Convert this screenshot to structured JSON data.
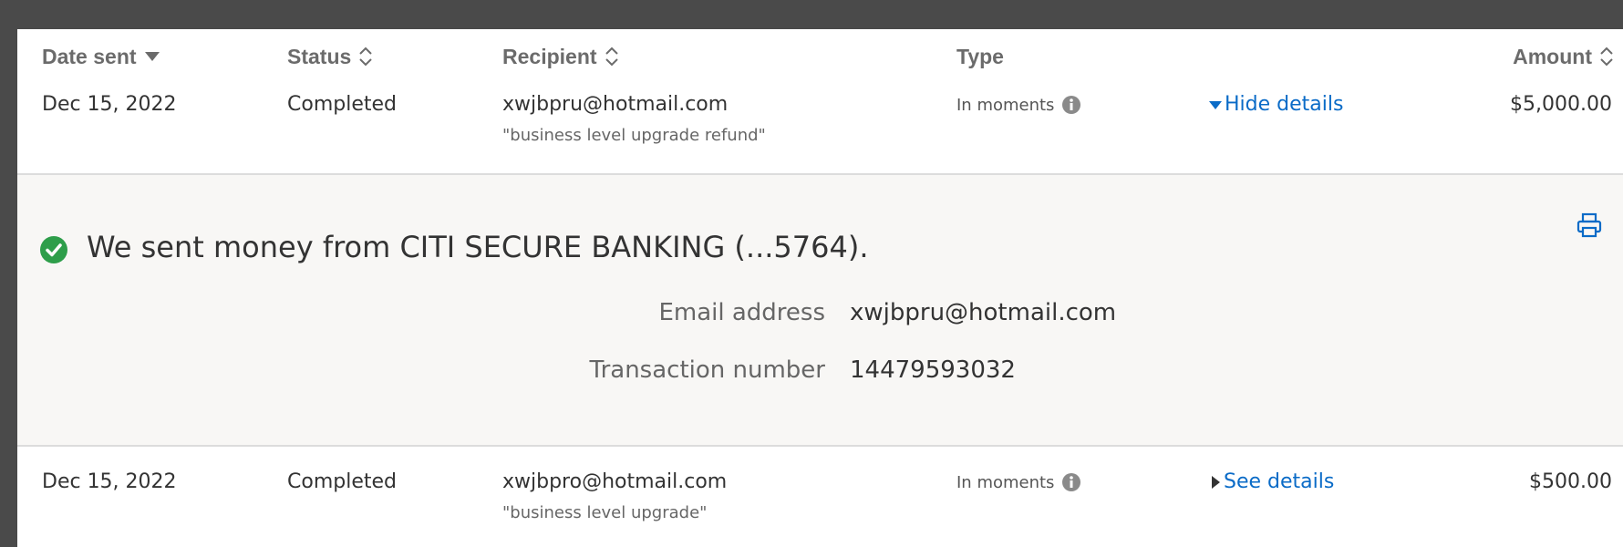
{
  "columns": {
    "date_sent": "Date sent",
    "status": "Status",
    "recipient": "Recipient",
    "type": "Type",
    "amount": "Amount"
  },
  "rows": [
    {
      "date": "Dec 15, 2022",
      "status": "Completed",
      "recipient": "xwjbpru@hotmail.com",
      "memo": "\"business level upgrade refund\"",
      "type": "In moments",
      "toggle_label": "Hide details",
      "amount": "$5,000.00"
    },
    {
      "date": "Dec 15, 2022",
      "status": "Completed",
      "recipient": "xwjbpro@hotmail.com",
      "memo": "\"business level upgrade\"",
      "type": "In moments",
      "toggle_label": "See details",
      "amount": "$500.00"
    }
  ],
  "details": {
    "headline": "We sent money from CITI SECURE BANKING (...5764).",
    "email_label": "Email address",
    "email_value": "xwjbpru@hotmail.com",
    "txn_label": "Transaction number",
    "txn_value": "14479593032"
  },
  "colors": {
    "link": "#0a6bc7",
    "success": "#2e9e4a",
    "details_bg": "#f8f7f5"
  }
}
